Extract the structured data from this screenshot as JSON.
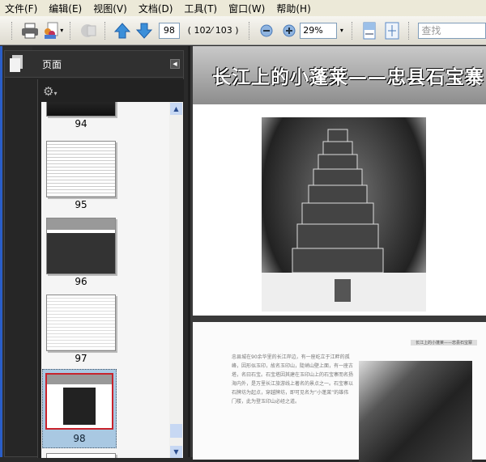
{
  "menu": [
    "文件(F)",
    "编辑(E)",
    "视图(V)",
    "文档(D)",
    "工具(T)",
    "窗口(W)",
    "帮助(H)"
  ],
  "toolbar": {
    "current_page": "98",
    "page_count": "( 102⁄ 103 )",
    "zoom": "29%",
    "search_placeholder": "查找"
  },
  "panel": {
    "title": "页面"
  },
  "thumbnails": [
    {
      "label": "94"
    },
    {
      "label": "95"
    },
    {
      "label": "96"
    },
    {
      "label": "97"
    },
    {
      "label": "98",
      "selected": true
    }
  ],
  "document": {
    "page1_title": "长江上的小蓬莱——忠县石宝寨",
    "page2_header": "长江上的小蓬莱——忠县石宝寨",
    "page2_text": "忠县城在90余华里的长江岸边，有一座屹立于江畔的孤峰，因形似玉印，故名玉印山，陡峭山壁上面，有一座古塔，名曰石宝。石宝塔因其建在玉印山上的石宝寨而名扬海内外，是万里长江旅游线上著名的景点之一。石宝寨以石牌坊为起点，穿越牌坊，即可见名为“小蓬莱”的雄伟门楼，此为登玉印山必经之道。"
  },
  "colors": {
    "accent": "#2a5ec8",
    "selection": "#c8232c"
  }
}
